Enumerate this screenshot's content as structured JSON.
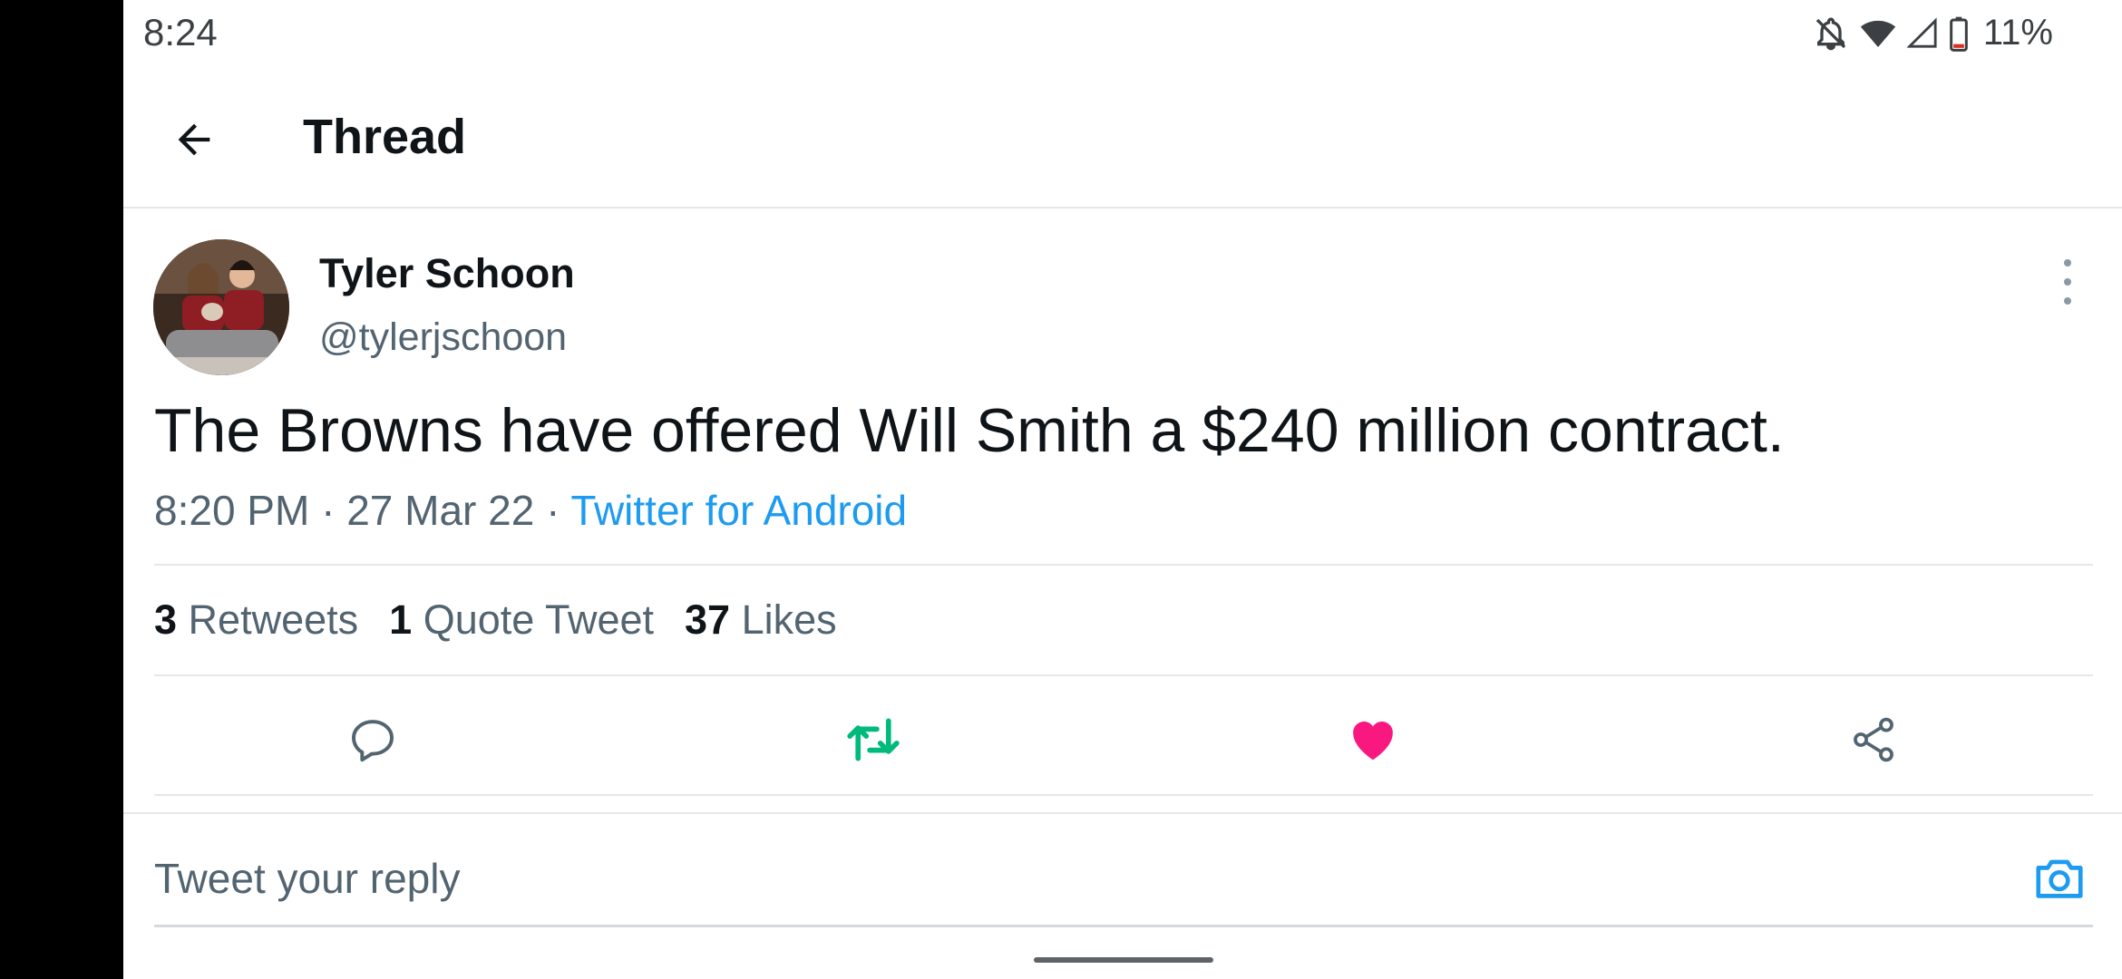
{
  "status_bar": {
    "time": "8:24",
    "battery": "11%",
    "icons": [
      "notifications-off-icon",
      "wifi-icon",
      "cell-signal-icon",
      "battery-low-icon"
    ]
  },
  "header": {
    "title": "Thread",
    "back_icon": "arrow-left-icon"
  },
  "tweet": {
    "author_name": "Tyler Schoon",
    "author_handle": "@tylerjschoon",
    "text": "The Browns have offered Will Smith a $240 million contract.",
    "time": "8:20 PM",
    "date": "27 Mar 22",
    "separator": " · ",
    "source": "Twitter for Android",
    "stats": {
      "retweets_count": "3",
      "retweets_label": "Retweets",
      "quotes_count": "1",
      "quotes_label": "Quote Tweet",
      "likes_count": "37",
      "likes_label": "Likes"
    },
    "actions": [
      "reply-icon",
      "retweet-icon",
      "like-icon",
      "share-icon"
    ],
    "retweeted": true,
    "liked": true
  },
  "reply": {
    "placeholder": "Tweet your reply",
    "camera_icon": "camera-icon"
  },
  "colors": {
    "accent": "#1d9bf0",
    "retweet": "#00ba7c",
    "like": "#f91880",
    "text_primary": "#0f1419",
    "text_secondary": "#536471"
  }
}
